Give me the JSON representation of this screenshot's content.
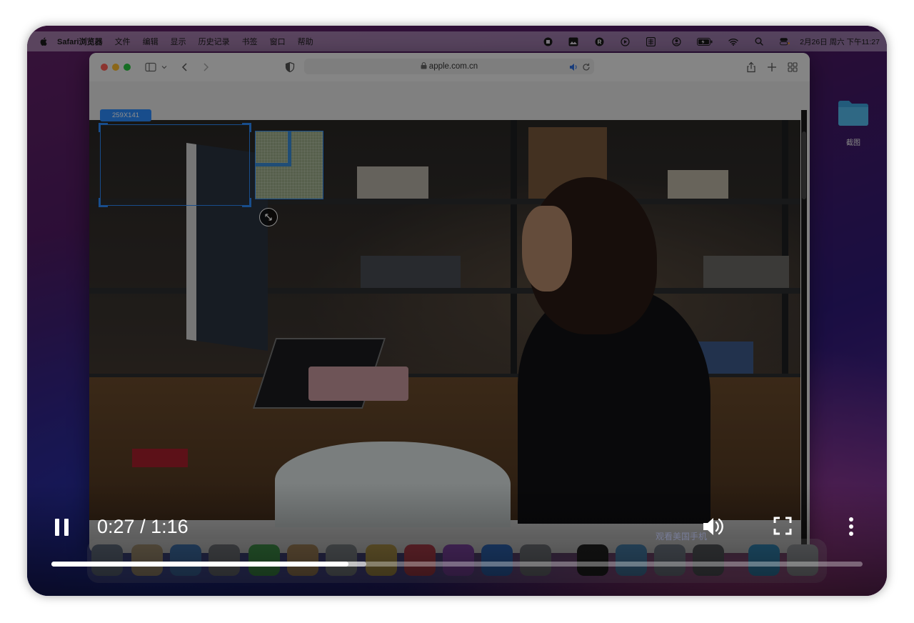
{
  "menubar": {
    "apple_icon": "apple-icon",
    "items": [
      "Safari浏览器",
      "文件",
      "编辑",
      "显示",
      "历史记录",
      "书签",
      "窗口",
      "帮助"
    ],
    "status_icons": [
      "stop-record-icon",
      "photo-icon",
      "r-circle-icon",
      "play-circle-icon",
      "input-method-icon",
      "user-circle-icon",
      "battery-icon",
      "wifi-icon",
      "search-icon",
      "control-center-icon"
    ],
    "clock": "2月26日 周六 下午11:27"
  },
  "safari": {
    "address": "apple.com.cn",
    "icons": [
      "sidebar-icon",
      "chevron-down-icon",
      "back-icon",
      "forward-icon",
      "shield-icon",
      "lock-icon",
      "speaker-icon",
      "reload-icon",
      "share-icon",
      "new-tab-icon",
      "tab-overview-icon"
    ]
  },
  "desktop": {
    "folder_label": "截图"
  },
  "selection": {
    "width_label": "259",
    "x_label": "X",
    "height_label": "141"
  },
  "player": {
    "current_time": "0:27",
    "separator": "/",
    "duration": "1:16",
    "progress_fraction": 0.366,
    "buffered_fraction": 0.388,
    "caption_ghost": "观看美国手机"
  },
  "colors": {
    "accent": "#2d8cff",
    "progress": "#ffffff"
  }
}
